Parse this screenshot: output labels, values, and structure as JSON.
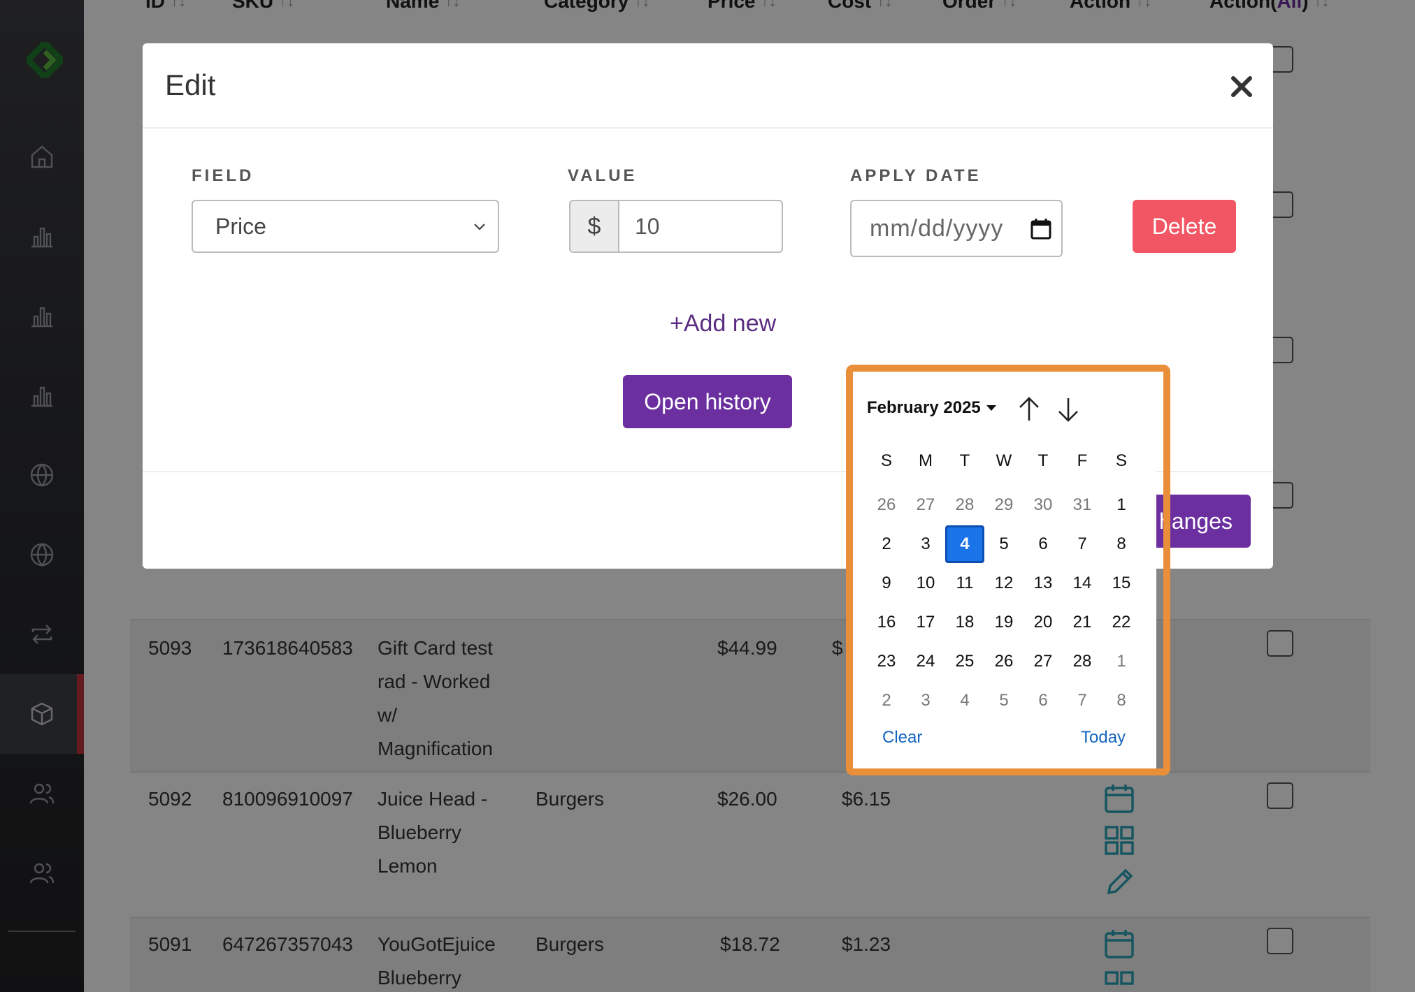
{
  "table": {
    "headers": [
      "ID",
      "SKU",
      "Name",
      "Category",
      "Price",
      "Cost",
      "Order",
      "Action",
      "Action(",
      "All",
      ")"
    ],
    "rows": [
      {
        "id": "5093",
        "sku": "173618640583",
        "name": [
          "Gift Card test",
          "rad - Worked",
          "w/",
          "Magnification"
        ],
        "category": "",
        "price": "$44.99",
        "cost": "$"
      },
      {
        "id": "5092",
        "sku": "810096910097",
        "name": [
          "Juice Head -",
          "Blueberry",
          "Lemon"
        ],
        "category": "Burgers",
        "price": "$26.00",
        "cost": "$6.15"
      },
      {
        "id": "5091",
        "sku": "647267357043",
        "name": [
          "YouGotEjuice",
          "Blueberry"
        ],
        "category": "Burgers",
        "price": "$18.72",
        "cost": "$1.23"
      }
    ]
  },
  "modal": {
    "title": "Edit",
    "labels": {
      "field": "FIELD",
      "value": "VALUE",
      "apply_date": "APPLY DATE"
    },
    "field_selected": "Price",
    "currency_prefix": "$",
    "value": "10",
    "date_placeholder": "mm/dd/yyyy",
    "delete_label": "Delete",
    "add_new_label": "+Add new",
    "open_history_label": "Open history",
    "save_label_visible": "hanges"
  },
  "datepicker": {
    "month_label": "February 2025",
    "weekdays": [
      "S",
      "M",
      "T",
      "W",
      "T",
      "F",
      "S"
    ],
    "weeks": [
      [
        "26",
        "27",
        "28",
        "29",
        "30",
        "31",
        "1"
      ],
      [
        "2",
        "3",
        "4",
        "5",
        "6",
        "7",
        "8"
      ],
      [
        "9",
        "10",
        "11",
        "12",
        "13",
        "14",
        "15"
      ],
      [
        "16",
        "17",
        "18",
        "19",
        "20",
        "21",
        "22"
      ],
      [
        "23",
        "24",
        "25",
        "26",
        "27",
        "28",
        "1"
      ],
      [
        "2",
        "3",
        "4",
        "5",
        "6",
        "7",
        "8"
      ]
    ],
    "selected_day": "4",
    "clear_label": "Clear",
    "today_label": "Today"
  },
  "colors": {
    "primary": "#6b2fa0",
    "danger": "#f25564",
    "picker_highlight": "#e98f3a",
    "selected_day": "#1a73e8",
    "action_icon": "#2aa3b8"
  }
}
